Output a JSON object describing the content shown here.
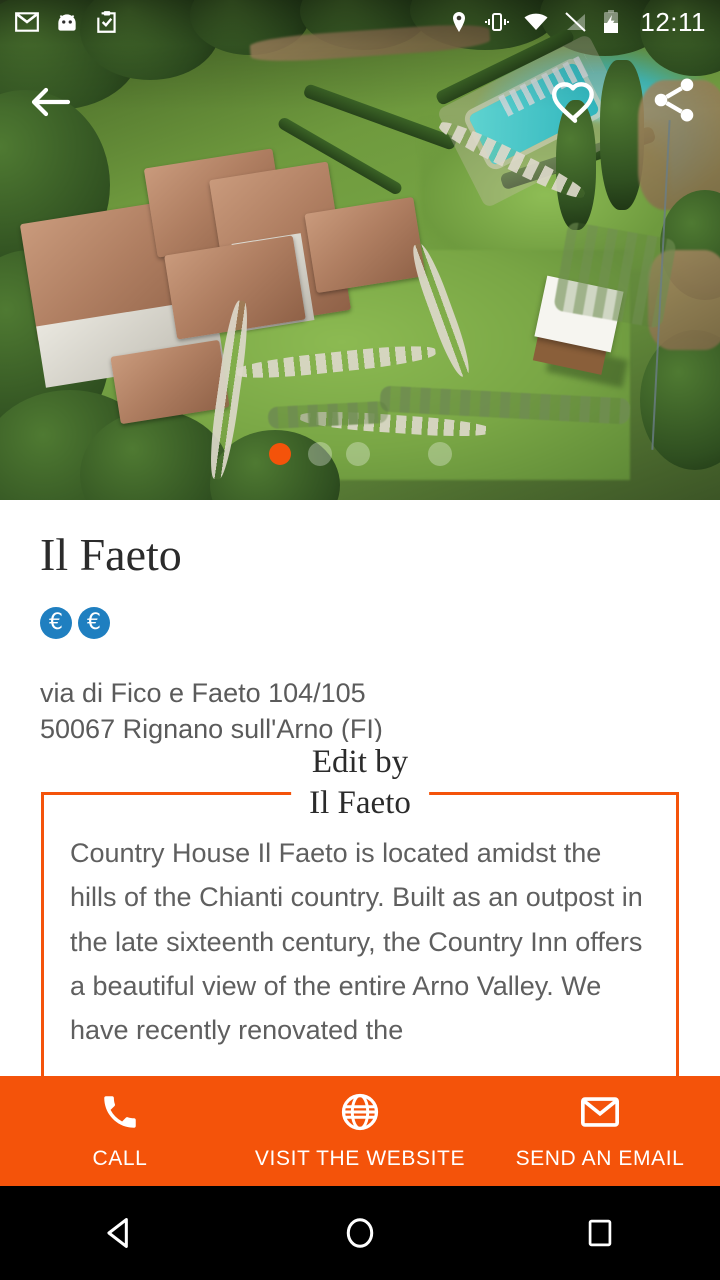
{
  "status_bar": {
    "time": "12:11",
    "left_icons": [
      "gmail-icon",
      "android-head-icon",
      "clipboard-check-icon"
    ],
    "right_icons": [
      "location-pin-icon",
      "vibrate-icon",
      "wifi-icon",
      "signal-off-icon",
      "battery-charging-icon"
    ]
  },
  "hero": {
    "image_description": "Aerial photo of Tuscan country house with terracotta roofs, green lawn, stone pathways, swimming pool and gazebo",
    "back_icon": "back-arrow-icon",
    "favorite_icon": "heart-outline-icon",
    "share_icon": "share-icon",
    "carousel": {
      "total": 4,
      "active_index": 0,
      "active_color": "#f4530a",
      "idle_color": "rgba(255,255,255,0.30)"
    }
  },
  "listing": {
    "title": "Il Faeto",
    "price_level": {
      "symbol": "€",
      "count": 2,
      "color": "#1f7fc0"
    },
    "address_line1": "via di Fico e Faeto 104/105",
    "address_line2": "50067 Rignano sull'Arno (FI)"
  },
  "edit_box": {
    "legend_line1": "Edit by",
    "legend_line2": "Il Faeto",
    "border_color": "#f4530a",
    "body": "Country House Il Faeto is located amidst the hills of the Chianti country. Built as an outpost in the late sixteenth century, the Country Inn offers a beautiful view of the entire Arno Valley. We have recently renovated the"
  },
  "action_bar": {
    "background": "#f4530a",
    "actions": [
      {
        "icon": "phone-icon",
        "label": "CALL"
      },
      {
        "icon": "globe-icon",
        "label": "VISIT THE WEBSITE"
      },
      {
        "icon": "envelope-icon",
        "label": "SEND AN EMAIL"
      }
    ]
  },
  "nav_bar": {
    "back": "triangle-back-icon",
    "home": "circle-home-icon",
    "recents": "square-recents-icon"
  }
}
